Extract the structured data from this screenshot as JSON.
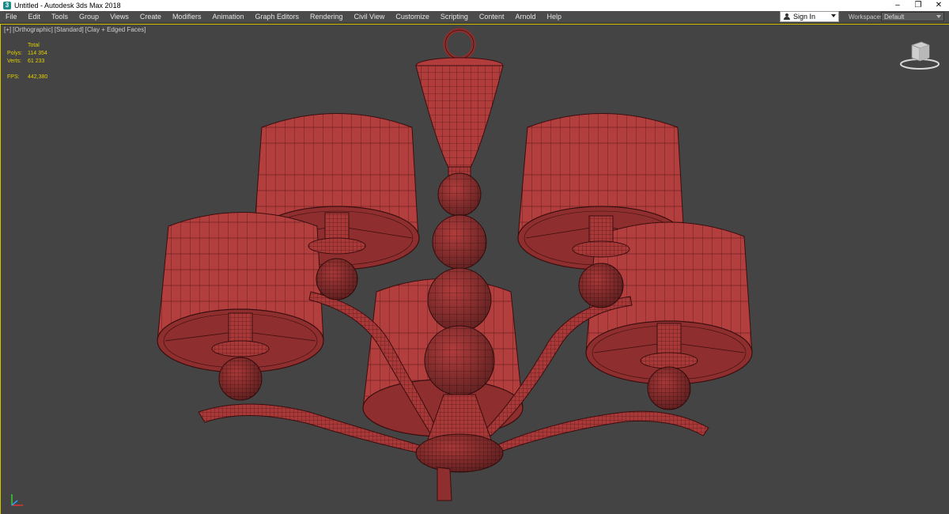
{
  "titlebar": {
    "icon_letter": "3",
    "title": "Untitled - Autodesk 3ds Max 2018",
    "minimize": "–",
    "restore": "❐",
    "close": "✕"
  },
  "menu": {
    "items": [
      "File",
      "Edit",
      "Tools",
      "Group",
      "Views",
      "Create",
      "Modifiers",
      "Animation",
      "Graph Editors",
      "Rendering",
      "Civil View",
      "Customize",
      "Scripting",
      "Content",
      "Arnold",
      "Help"
    ],
    "signin_label": "Sign In",
    "workspaces_label": "Workspaces:",
    "workspace_value": "Default"
  },
  "viewport": {
    "labels": [
      "[+]",
      "[Orthographic]",
      "[Standard]",
      "[Clay + Edged Faces]"
    ],
    "stats": {
      "total_label": "Total",
      "polys_label": "Polys:",
      "polys_value": "114 354",
      "verts_label": "Verts:",
      "verts_value": "61 233",
      "fps_label": "FPS:",
      "fps_value": "442,380"
    }
  },
  "colors": {
    "mesh_fill": "#b03c3c",
    "mesh_dark": "#7a2222",
    "wire": "#3a0e0e",
    "viewport_bg": "#444444",
    "active_border": "#d6c400",
    "stats_text": "#e0d000"
  },
  "icons": {
    "app": "3ds-max-icon",
    "signin": "user-icon",
    "viewcube": "viewcube-icon",
    "axis": "axis-tripod-icon"
  }
}
